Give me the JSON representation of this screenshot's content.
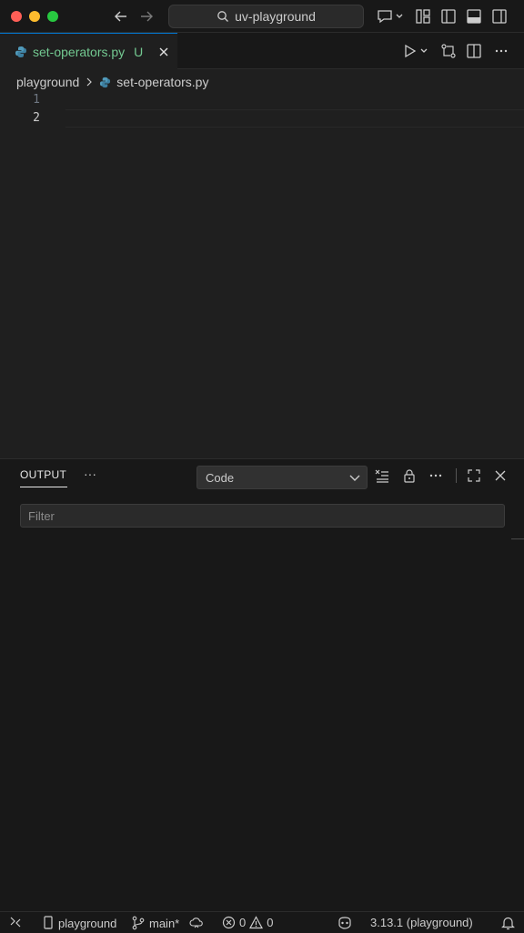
{
  "titlebar": {
    "search_label": "uv-playground"
  },
  "tabs": [
    {
      "label": "set-operators.py",
      "status": "U"
    }
  ],
  "breadcrumb": {
    "folder": "playground",
    "file": "set-operators.py"
  },
  "editor": {
    "line_numbers": [
      "1",
      "2"
    ]
  },
  "panel": {
    "tab_label": "OUTPUT",
    "more_label": "···",
    "channel_selected": "Code",
    "filter_placeholder": "Filter"
  },
  "statusbar": {
    "workspace": "playground",
    "branch": "main*",
    "errors": "0",
    "warnings": "0",
    "interpreter": "3.13.1 (playground)"
  },
  "colors": {
    "accent": "#0078d4",
    "untracked": "#73c991",
    "python_icon": "#519aba"
  }
}
